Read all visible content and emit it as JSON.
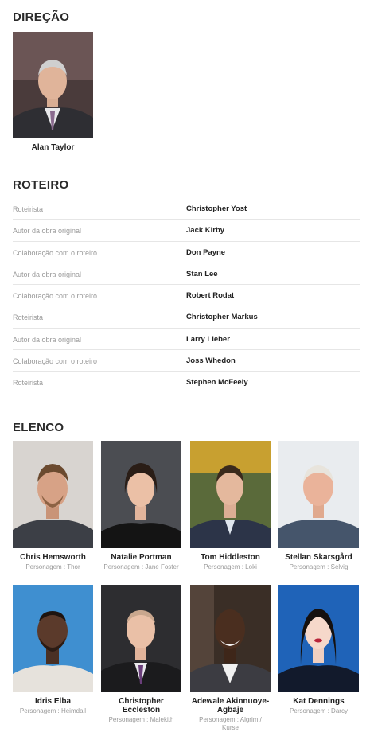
{
  "direction": {
    "title": "DIREÇÃO",
    "people": [
      {
        "name": "Alan Taylor",
        "photo_icon": "director-portrait"
      }
    ]
  },
  "writing": {
    "title": "ROTEIRO",
    "rows": [
      {
        "job": "Roteirista",
        "name": "Christopher Yost"
      },
      {
        "job": "Autor da obra original",
        "name": "Jack Kirby"
      },
      {
        "job": "Colaboração com o roteiro",
        "name": "Don Payne"
      },
      {
        "job": "Autor da obra original",
        "name": "Stan Lee"
      },
      {
        "job": "Colaboração com o roteiro",
        "name": "Robert Rodat"
      },
      {
        "job": "Roteirista",
        "name": "Christopher Markus"
      },
      {
        "job": "Autor da obra original",
        "name": "Larry Lieber"
      },
      {
        "job": "Colaboração com o roteiro",
        "name": "Joss Whedon"
      },
      {
        "job": "Roteirista",
        "name": "Stephen McFeely"
      }
    ]
  },
  "cast": {
    "title": "ELENCO",
    "members": [
      {
        "name": "Chris Hemsworth",
        "role": "Personagem : Thor"
      },
      {
        "name": "Natalie Portman",
        "role": "Personagem : Jane Foster"
      },
      {
        "name": "Tom Hiddleston",
        "role": "Personagem : Loki"
      },
      {
        "name": "Stellan Skarsgård",
        "role": "Personagem : Selvig"
      },
      {
        "name": "Idris Elba",
        "role": "Personagem : Heimdall"
      },
      {
        "name": "Christopher Eccleston",
        "role": "Personagem : Malekith"
      },
      {
        "name": "Adewale Akinnuoye-Agbaje",
        "role": "Personagem : Algrim / Kurse"
      },
      {
        "name": "Kat Dennings",
        "role": "Personagem : Darcy"
      }
    ]
  },
  "colors": {
    "heading": "#2a2a2a",
    "job_text": "#9a9a9a",
    "divider": "#e6e6e6"
  }
}
